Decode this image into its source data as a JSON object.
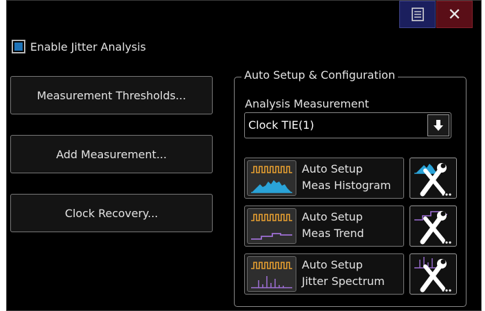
{
  "window": {
    "menu_icon": "menu-icon",
    "close_icon": "close-icon",
    "close_glyph": "✕"
  },
  "enable_jitter": {
    "label": "Enable Jitter Analysis",
    "checked": true
  },
  "buttons": {
    "thresholds": "Measurement Thresholds...",
    "add_measurement": "Add Measurement...",
    "clock_recovery": "Clock Recovery..."
  },
  "auto_setup": {
    "group_title": "Auto Setup & Configuration",
    "analysis_label": "Analysis Measurement",
    "analysis_value": "Clock TIE(1)",
    "histogram": {
      "line1": "Auto Setup",
      "line2": "Meas Histogram"
    },
    "trend": {
      "line1": "Auto Setup",
      "line2": "Meas Trend"
    },
    "spectrum": {
      "line1": "Auto Setup",
      "line2": "Jitter Spectrum"
    }
  },
  "colors": {
    "accent_blue": "#2aa3d8",
    "accent_purple": "#a070d8",
    "clock_orange": "#e8a030",
    "checkbox_fill": "#1f74b8"
  }
}
